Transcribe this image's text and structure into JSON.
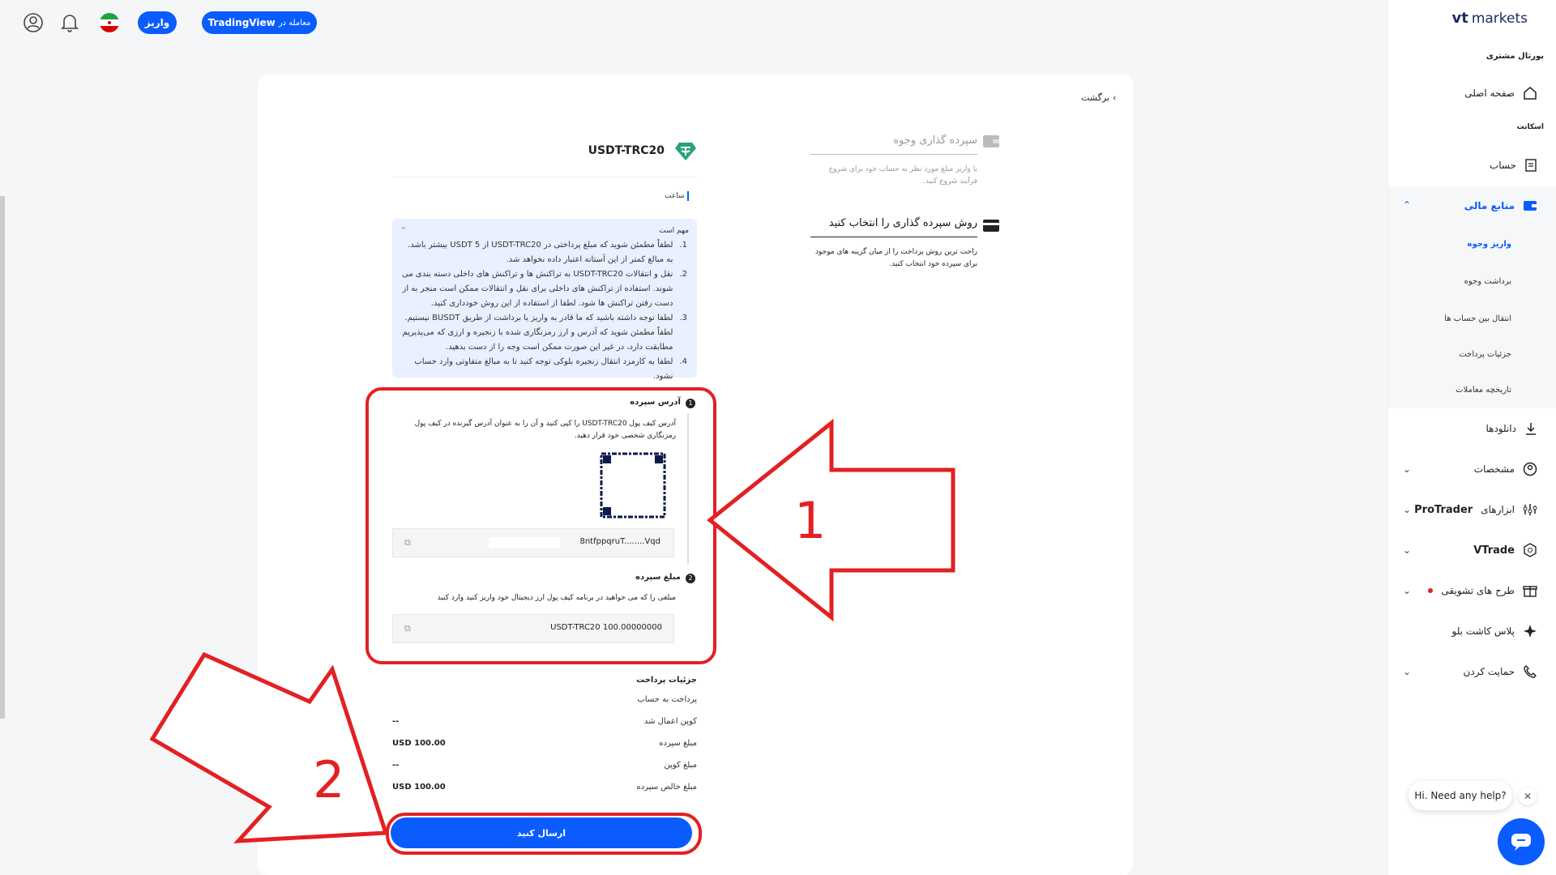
{
  "header": {
    "trading_label": "معامله در",
    "trading_brand": "TradingView",
    "deposit_label": "واریز"
  },
  "back": {
    "label": "برگشت"
  },
  "steps": {
    "step1_title": "سپرده گذاری وجوه",
    "step1_desc": "با واریز مبلغ مورد نظر به حساب خود برای شروع فرآیند شروع کنید.",
    "step2_title": "روش سپرده گذاری را انتخاب کنید",
    "step2_desc": "راحت ترین روش پرداخت را از میان گزینه های موجود برای سپرده خود انتخاب کنید."
  },
  "method": {
    "title": "USDT-TRC20",
    "tab": "ساعت"
  },
  "notice": {
    "title": "مهم است",
    "items": [
      {
        "n": "1.",
        "text": "لطفاً مطمئن شوید که مبلغ پرداختی در USDT-TRC20 از USDT 5 بیشتر باشد. به مبالغ کمتر از این آستانه اعتبار داده نخواهد شد."
      },
      {
        "n": "2.",
        "text": "نقل و انتقالات USDT-TRC20 به تراکنش ها و تراکنش های داخلی دسته بندی می شوند. استفاده از تراکنش های داخلی برای نقل و انتقالات ممکن است منجر به از دست رفتن تراکنش ها شود. لطفا از استفاده از این روش خودداری کنید."
      },
      {
        "n": "3.",
        "text": "لطفا توجه داشته باشید که ما قادر به واریز یا برداشت از طریق BUSDT نیستیم. لطفاً مطمئن شوید که آدرس و ارز رمزنگاری شده با زنجیره و ارزی که می‌پذیریم مطابقت دارد، در غیر این صورت ممکن است وجه را از دست بدهید."
      },
      {
        "n": "4.",
        "text": "لطفا به کارمزد انتقال زنجیره بلوکی توجه کنید تا به مبالغ متفاوتی وارد حساب نشود."
      }
    ]
  },
  "address": {
    "num": "1",
    "title": "آدرس سپرده",
    "desc": "آدرس کیف پول USDT-TRC20 را کپی کنید و آن را به عنوان آدرس گیرنده در کیف پول رمزنگاری شخصی خود قرار دهید.",
    "value": "8ntfppqruT........Vqd"
  },
  "amount": {
    "num": "2",
    "title": "مبلغ سپرده",
    "desc": "مبلغی را که می خواهید در برنامه کیف پول ارز دیجیتال خود واریز کنید وارد کنید",
    "value": "USDT-TRC20 100.00000000"
  },
  "details": {
    "title": "جزئیات پرداخت",
    "rows": [
      {
        "label": "پرداخت به حساب",
        "value": ""
      },
      {
        "label": "کوپن اعمال شد",
        "value": "--"
      },
      {
        "label": "مبلغ سپرده",
        "value": "USD 100.00"
      },
      {
        "label": "مبلغ کوپن",
        "value": "--"
      },
      {
        "label": "مبلغ خالص سپرده",
        "value": "USD 100.00"
      }
    ]
  },
  "submit_label": "ارسال کنید",
  "annotations": {
    "arrow1": "1",
    "arrow2": "2"
  },
  "sidebar": {
    "logo_mark": "vt",
    "logo_text": "markets",
    "portal_title": "پورتال مشتری",
    "home": "صفحه اصلی",
    "accounts_header": "اسکانت",
    "account": "حساب",
    "funds": "منابع مالی",
    "funds_sub": [
      "واریز وجوه",
      "برداشت وجوه",
      "انتقال بین حساب ها",
      "جزئیات پرداخت",
      "تاریخچه معاملات"
    ],
    "downloads": "دانلودها",
    "profile": "مشخصات",
    "protrader_label": "ابزارهای",
    "protrader_brand": "ProTrader",
    "vtrade": "VTrade",
    "promotions": "طرح های تشویقی",
    "cashback": "پلاس کاشت بلو",
    "support": "حمایت کردن"
  },
  "chat": {
    "bubble": "Hi. Need any help?"
  },
  "colors": {
    "accent": "#0a5cff",
    "annotation_red": "#e32022",
    "notice_bg": "#e9f0ff"
  }
}
